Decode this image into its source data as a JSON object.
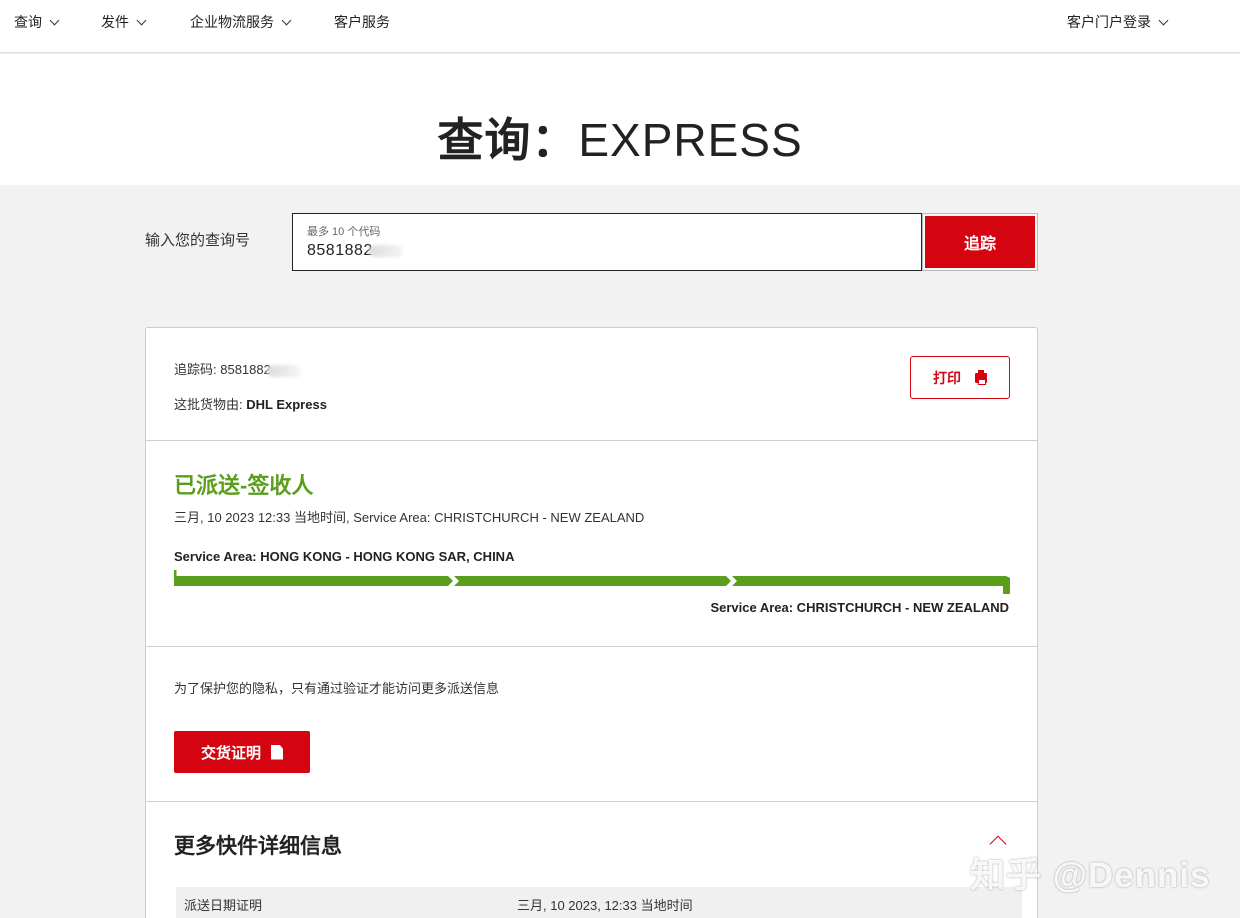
{
  "nav": {
    "items": [
      {
        "label": "查询"
      },
      {
        "label": "发件"
      },
      {
        "label": "企业物流服务"
      },
      {
        "label": "客户服务"
      }
    ],
    "login": "客户门户登录"
  },
  "hero": {
    "title_zh": "查询：",
    "title_en": "EXPRESS"
  },
  "search": {
    "label": "输入您的查询号",
    "placeholder": "最多 10 个代码",
    "value": "858188",
    "value_tail": "2",
    "button": "追踪"
  },
  "shipment": {
    "tracking_label": "追踪码: ",
    "tracking_value": "8581882",
    "carrier_label": "这批货物由: ",
    "carrier_value": "DHL Express",
    "print_button": "打印",
    "status": "已派送-签收人",
    "status_detail": "三月, 10 2023 12:33 当地时间, Service Area: CHRISTCHURCH - NEW ZEALAND",
    "origin": "Service Area: HONG KONG - HONG KONG SAR, CHINA",
    "destination": "Service Area: CHRISTCHURCH - NEW ZEALAND",
    "progress_color": "#5a9e1b",
    "progress": 1.0
  },
  "privacy": {
    "note": "为了保护您的隐私，只有通过验证才能访问更多派送信息",
    "pod_button": "交货证明"
  },
  "details": {
    "title": "更多快件详细信息",
    "rows": [
      {
        "key": "派送日期证明",
        "value": "三月, 10 2023, 12:33 当地时间"
      }
    ]
  },
  "colors": {
    "brand_red": "#d40511",
    "success_green": "#5a9e1b"
  },
  "watermark": "知乎 @Dennis"
}
